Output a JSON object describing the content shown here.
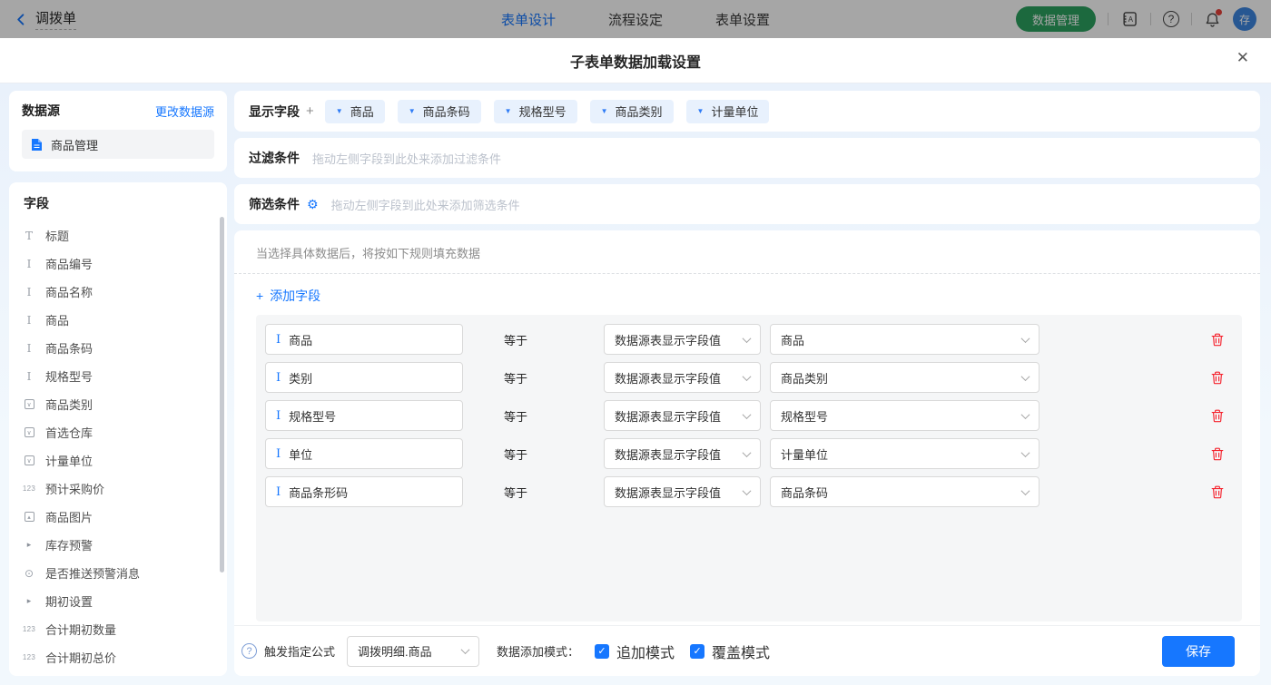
{
  "colors": {
    "accent": "#1677ff",
    "green": "#2ba160",
    "red": "#f5222d",
    "tag_bg": "#e8f1fd",
    "panel_bg": "#f5f6f7",
    "placeholder": "#bcc2cc"
  },
  "navbar": {
    "back_label": "调拨单",
    "tabs": [
      {
        "label": "表单设计",
        "active": true
      },
      {
        "label": "流程设定",
        "active": false
      },
      {
        "label": "表单设置",
        "active": false
      }
    ],
    "data_manage_label": "数据管理",
    "help_glyph": "?",
    "avatar_text": "存"
  },
  "modal": {
    "title": "子表单数据加载设置",
    "close_glyph": "✕"
  },
  "datasource": {
    "title": "数据源",
    "change_link": "更改数据源",
    "item": "商品管理"
  },
  "fields": {
    "title": "字段",
    "items": [
      {
        "icon": "title",
        "label": "标题"
      },
      {
        "icon": "text",
        "label": "商品编号"
      },
      {
        "icon": "text",
        "label": "商品名称"
      },
      {
        "icon": "text",
        "label": "商品"
      },
      {
        "icon": "text",
        "label": "商品条码"
      },
      {
        "icon": "text",
        "label": "规格型号"
      },
      {
        "icon": "select",
        "label": "商品类别"
      },
      {
        "icon": "select",
        "label": "首选仓库"
      },
      {
        "icon": "select",
        "label": "计量单位"
      },
      {
        "icon": "number",
        "label": "预计采购价"
      },
      {
        "icon": "image",
        "label": "商品图片"
      },
      {
        "icon": "arrow",
        "label": "库存预警"
      },
      {
        "icon": "radio",
        "label": "是否推送预警消息"
      },
      {
        "icon": "arrow",
        "label": "期初设置"
      },
      {
        "icon": "number",
        "label": "合计期初数量"
      },
      {
        "icon": "number",
        "label": "合计期初总价"
      }
    ]
  },
  "display_fields": {
    "label": "显示字段",
    "plus": "+",
    "tags": [
      "商品",
      "商品条码",
      "规格型号",
      "商品类别",
      "计量单位"
    ]
  },
  "filter": {
    "label": "过滤条件",
    "placeholder": "拖动左侧字段到此处来添加过滤条件"
  },
  "screen": {
    "label": "筛选条件",
    "gear_glyph": "⚙",
    "placeholder": "拖动左侧字段到此处来添加筛选条件"
  },
  "rules": {
    "hint": "当选择具体数据后，将按如下规则填充数据",
    "add_label": "添加字段",
    "add_plus": "+",
    "rows": [
      {
        "field": "商品",
        "op": "等于",
        "source": "数据源表显示字段值",
        "value": "商品"
      },
      {
        "field": "类别",
        "op": "等于",
        "source": "数据源表显示字段值",
        "value": "商品类别"
      },
      {
        "field": "规格型号",
        "op": "等于",
        "source": "数据源表显示字段值",
        "value": "规格型号"
      },
      {
        "field": "单位",
        "op": "等于",
        "source": "数据源表显示字段值",
        "value": "计量单位"
      },
      {
        "field": "商品条形码",
        "op": "等于",
        "source": "数据源表显示字段值",
        "value": "商品条码"
      }
    ]
  },
  "footer": {
    "help_glyph": "?",
    "trigger_label": "触发指定公式",
    "trigger_value": "调拨明细.商品",
    "mode_label": "数据添加模式：",
    "modes": [
      {
        "label": "追加模式",
        "checked": true
      },
      {
        "label": "覆盖模式",
        "checked": true
      }
    ],
    "save_label": "保存"
  }
}
